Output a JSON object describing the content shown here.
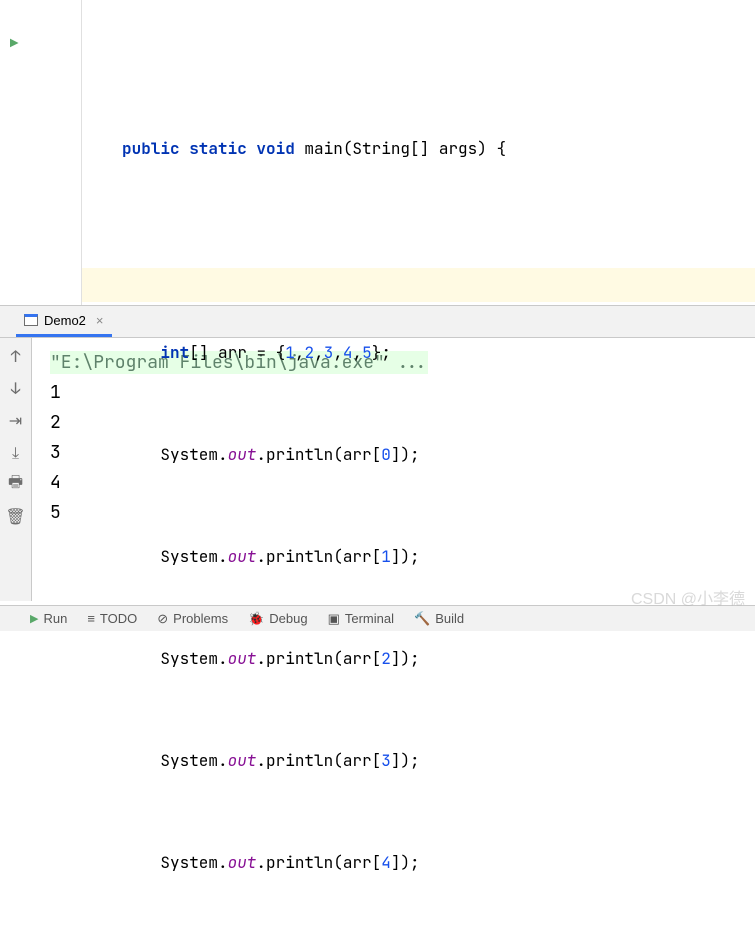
{
  "editor": {
    "method_signature": {
      "keywords": "public static void",
      "name": "main",
      "params_prefix": "(String[] ",
      "params_name": "args",
      "params_suffix": ") {"
    },
    "declaration": {
      "kw": "int",
      "brackets": "[] ",
      "var": "arr",
      "eq": " = {",
      "values": [
        "1",
        "2",
        "3",
        "4",
        "5"
      ],
      "close": "};"
    },
    "print_lines": [
      {
        "prefix": "System.",
        "field": "out",
        "call": ".println(arr[",
        "idx": "0",
        "suffix": "]);"
      },
      {
        "prefix": "System.",
        "field": "out",
        "call": ".println(arr[",
        "idx": "1",
        "suffix": "]);"
      },
      {
        "prefix": "System.",
        "field": "out",
        "call": ".println(arr[",
        "idx": "2",
        "suffix": "]);"
      },
      {
        "prefix": "System.",
        "field": "out",
        "call": ".println(arr[",
        "idx": "3",
        "suffix": "]);"
      },
      {
        "prefix": "System.",
        "field": "out",
        "call": ".println(arr[",
        "idx": "4",
        "suffix": "]);"
      }
    ]
  },
  "run": {
    "tab_name": "Demo2",
    "command": "\"E:\\Program Files\\bin\\java.exe\" ...",
    "output": [
      "1",
      "2",
      "3",
      "4",
      "5"
    ]
  },
  "bottom": {
    "run": "Run",
    "todo": "TODO",
    "problems": "Problems",
    "debug": "Debug",
    "terminal": "Terminal",
    "build": "Build"
  },
  "watermark": "CSDN @小李德"
}
